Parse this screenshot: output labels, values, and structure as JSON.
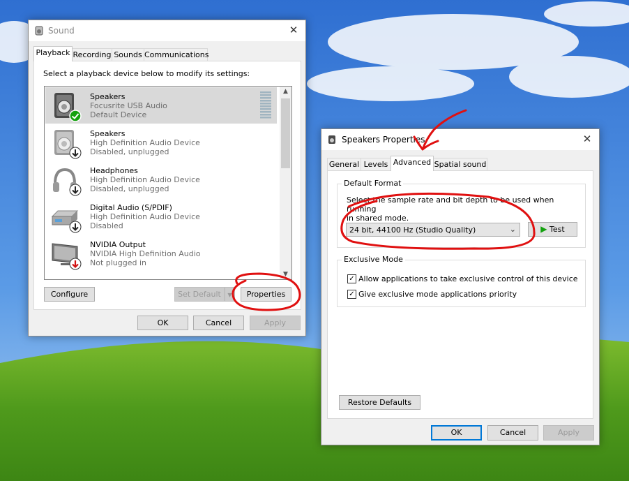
{
  "sound_dialog": {
    "title": "Sound",
    "tabs": [
      "Playback",
      "Recording",
      "Sounds",
      "Communications"
    ],
    "instruction": "Select a playback device below to modify its settings:",
    "devices": [
      {
        "name": "Speakers",
        "driver": "Focusrite USB Audio",
        "status": "Default Device",
        "badge": "check-icon"
      },
      {
        "name": "Speakers",
        "driver": "High Definition Audio Device",
        "status": "Disabled, unplugged",
        "badge": "down-arrow-icon"
      },
      {
        "name": "Headphones",
        "driver": "High Definition Audio Device",
        "status": "Disabled, unplugged",
        "badge": "down-arrow-icon"
      },
      {
        "name": "Digital Audio (S/PDIF)",
        "driver": "High Definition Audio Device",
        "status": "Disabled",
        "badge": "down-arrow-icon"
      },
      {
        "name": "NVIDIA Output",
        "driver": "NVIDIA High Definition Audio",
        "status": "Not plugged in",
        "badge": "red-down-arrow-icon"
      }
    ],
    "configure_label": "Configure",
    "set_default_label": "Set Default",
    "properties_label": "Properties",
    "ok_label": "OK",
    "cancel_label": "Cancel",
    "apply_label": "Apply"
  },
  "props_dialog": {
    "title": "Speakers Properties",
    "tabs": [
      "General",
      "Levels",
      "Advanced",
      "Spatial sound"
    ],
    "default_format": {
      "heading": "Default Format",
      "description_line1": "Select the sample rate and bit depth to be used when running",
      "description_line2": "in shared mode.",
      "selected_format": "24 bit, 44100 Hz (Studio Quality)",
      "test_label": "Test"
    },
    "exclusive_mode": {
      "heading": "Exclusive Mode",
      "option1": "Allow applications to take exclusive control of this device",
      "option1_checked": true,
      "option2": "Give exclusive mode applications priority",
      "option2_checked": true
    },
    "restore_defaults_label": "Restore Defaults",
    "ok_label": "OK",
    "cancel_label": "Cancel",
    "apply_label": "Apply"
  },
  "colors": {
    "accent": "#0078d7",
    "annotation": "#e01010",
    "check_green": "#13a10e"
  }
}
